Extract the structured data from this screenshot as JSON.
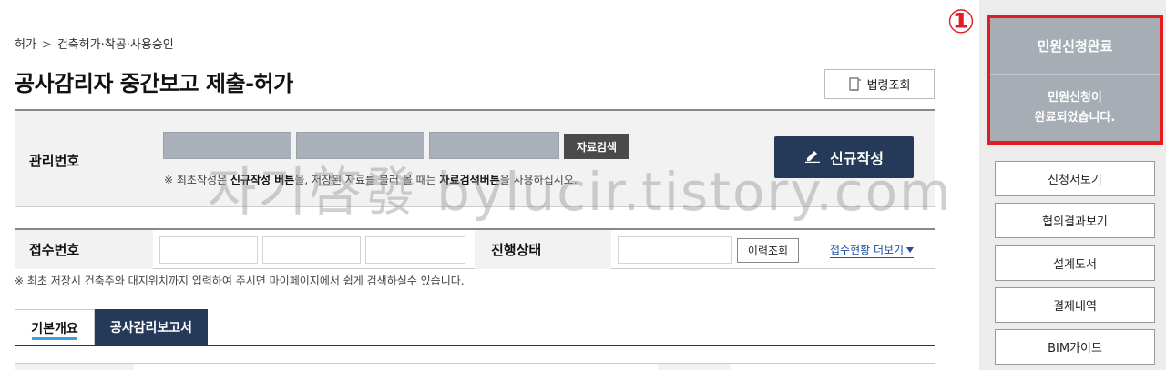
{
  "breadcrumb": {
    "home": "허가",
    "separator": ">",
    "current": "건축허가·착공·사용승인"
  },
  "page_title": "공사감리자 중간보고 제출-허가",
  "law_button": {
    "icon": "book-icon",
    "label": "법령조회"
  },
  "management": {
    "label": "관리번호",
    "search_label": "자료검색",
    "note_prefix": "※ 최초작성은 ",
    "note_bold1": "신규작성 버튼",
    "note_mid": "을, 저장된 자료를 불러 올 때는 ",
    "note_bold2": "자료검색버튼",
    "note_suffix": "을 사용하십시오.",
    "new_button": {
      "icon": "pencil-icon",
      "label": "신규작성"
    }
  },
  "receipt": {
    "label": "접수번호",
    "status_label": "진행상태",
    "history_label": "이력조회",
    "more_label": "접수현황 더보기",
    "note": "※ 최초 저장시 건축주와 대지위치까지 입력하여 주시면 마이페이지에서 쉽게 검색하실수 있습니다."
  },
  "tabs": [
    {
      "label": "기본개요",
      "active": true
    },
    {
      "label": "공사감리보고서",
      "active": false
    }
  ],
  "watermark": "자기啓發 bylucir.tistory.com",
  "side": {
    "marker": "①",
    "status_title": "민원신청완료",
    "status_msg_line1": "민원신청이",
    "status_msg_line2": "완료되었습니다.",
    "buttons": [
      "신청서보기",
      "협의결과보기",
      "설계도서",
      "결제내역",
      "BIM가이드"
    ]
  },
  "colors": {
    "accent": "#253a59",
    "highlight": "#e31b23",
    "status_bg": "#a6adb5"
  }
}
